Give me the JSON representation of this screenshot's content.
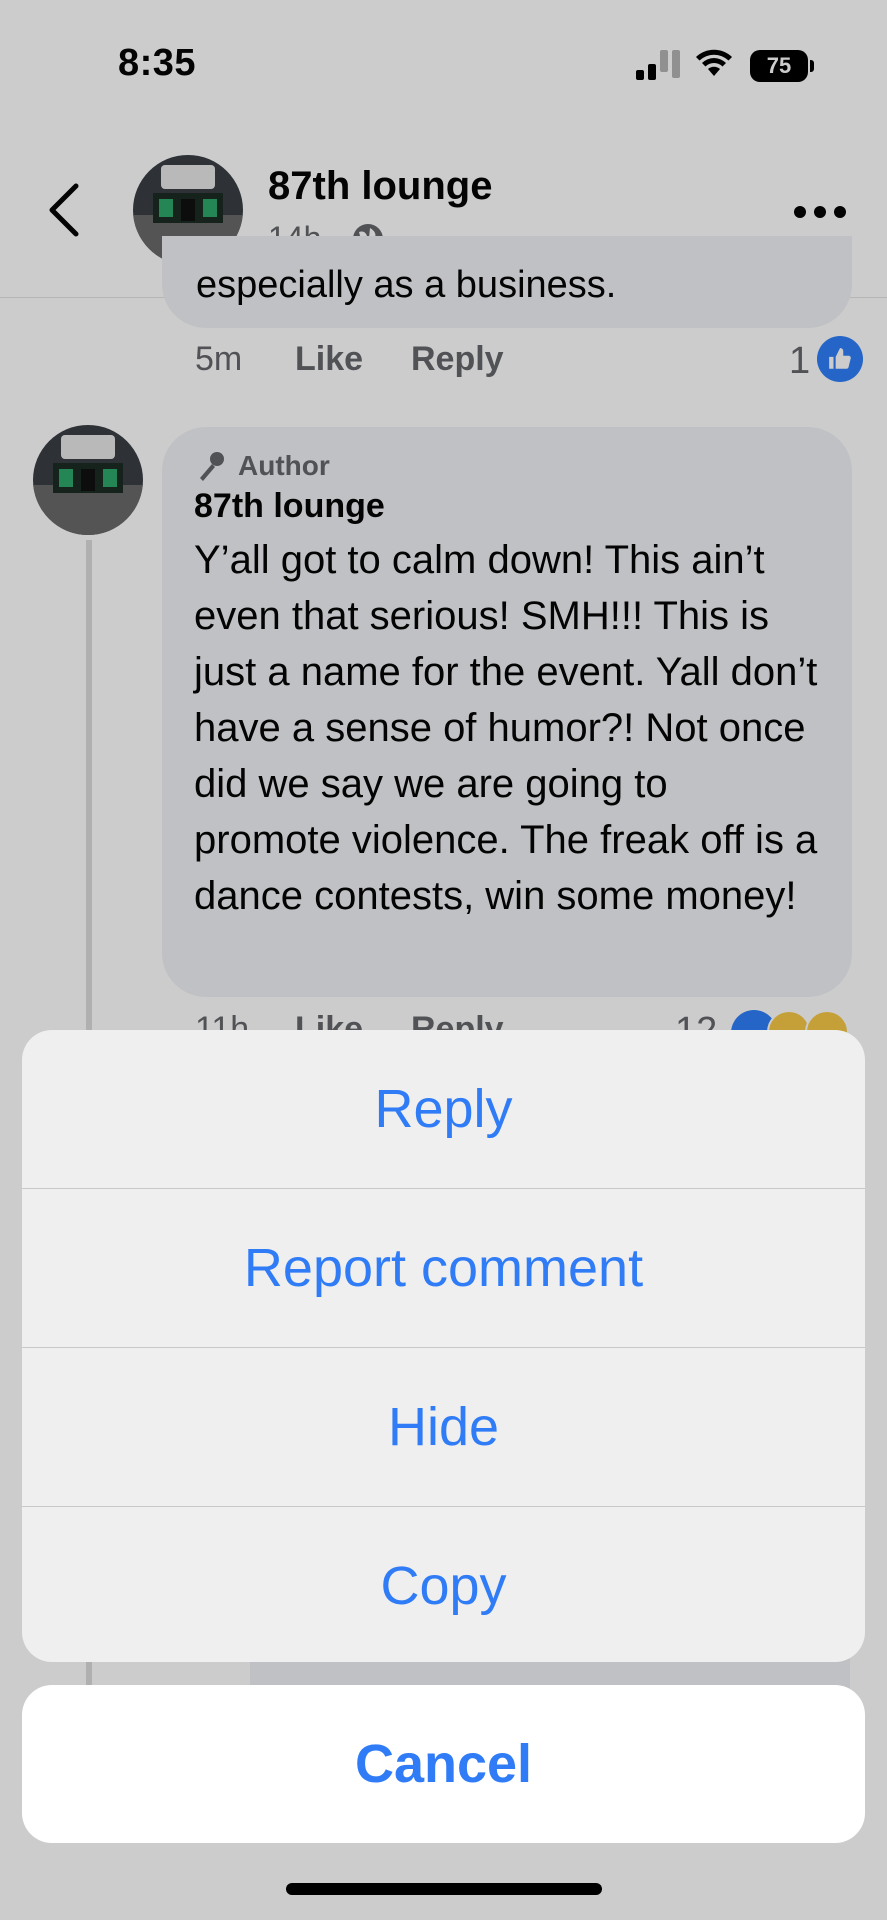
{
  "status_bar": {
    "time": "8:35",
    "battery": "75"
  },
  "header": {
    "title": "87th lounge",
    "meta_time": "14h ·",
    "avatar_label": "87th LOUNGE"
  },
  "previous_comment": {
    "partial_text": "especially as a business.",
    "time": "5m",
    "like_label": "Like",
    "reply_label": "Reply",
    "reaction_count": "1"
  },
  "comment": {
    "badge": "Author",
    "author": "87th lounge",
    "text": "Y’all got to calm down! This ain’t even that serious! SMH!!! This is just a name for the event. Yall don’t have a sense of humor?! Not once did we say we are going to promote violence. The freak off is a dance contests, win some money!",
    "time": "11h",
    "like_label": "Like",
    "reply_label": "Reply",
    "reaction_count": "12"
  },
  "action_sheet": {
    "items": [
      "Reply",
      "Report comment",
      "Hide",
      "Copy"
    ],
    "cancel": "Cancel"
  },
  "colors": {
    "accent": "#2f7cf6",
    "like_blue": "#2d7ff9",
    "sheet_bg": "#efefef"
  },
  "icons": [
    "back-chevron-icon",
    "globe-icon",
    "more-icon",
    "like-thumb-icon",
    "microphone-icon",
    "wifi-icon",
    "signal-icon"
  ]
}
